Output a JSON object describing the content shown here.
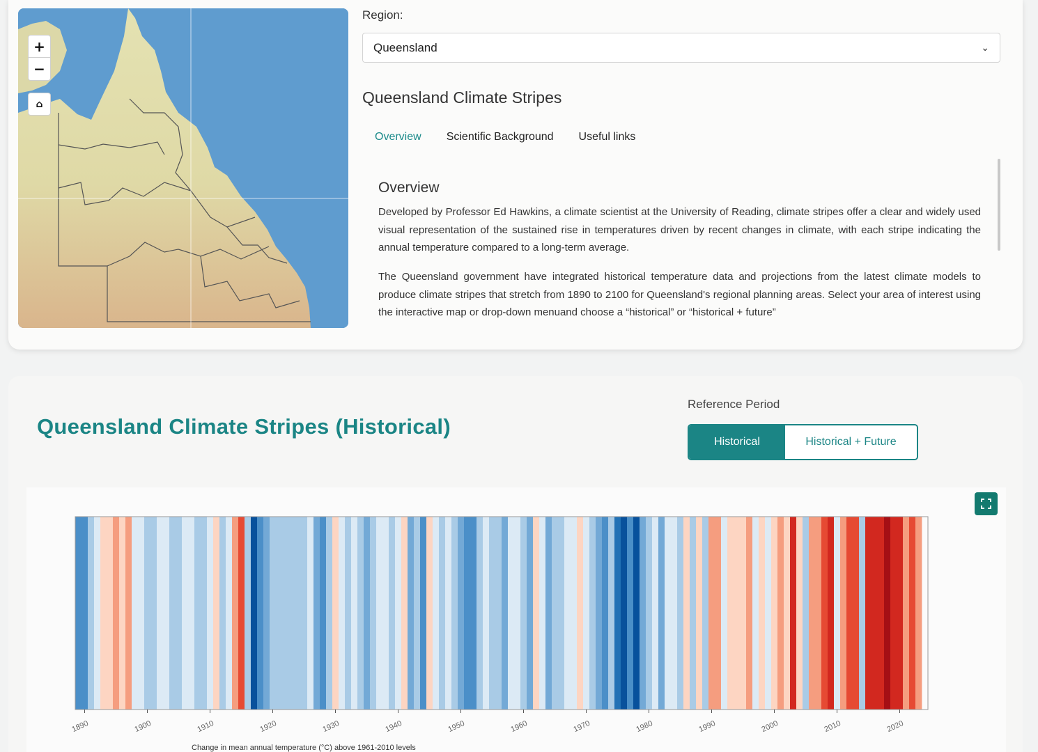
{
  "map": {
    "zoom_in_label": "+",
    "zoom_out_label": "−",
    "home_icon": "home-icon",
    "colors": {
      "sea": "#5f9ccf",
      "land": "#dcd9a6",
      "border": "#444444"
    }
  },
  "region": {
    "label": "Region:",
    "selected": "Queensland"
  },
  "info": {
    "title": "Queensland Climate Stripes",
    "tabs": [
      {
        "label": "Overview",
        "active": true
      },
      {
        "label": "Scientific Background",
        "active": false
      },
      {
        "label": "Useful links",
        "active": false
      }
    ],
    "overview_heading": "Overview",
    "paragraph_1": "Developed by Professor Ed Hawkins, a climate scientist at the University of Reading, climate stripes offer a clear and widely used visual representation of the sustained rise in temperatures driven by recent changes in climate, with each stripe indicating the annual temperature compared to a long-term average.",
    "paragraph_2": "The Queensland government have integrated historical temperature data and projections from the latest climate models to produce climate stripes that stretch from 1890 to 2100 for Queensland's regional planning areas. Select your area of interest using the interactive map or drop-down menuand choose a “historical” or “historical + future”"
  },
  "stripes_section": {
    "title": "Queensland Climate Stripes (Historical)",
    "reference_label": "Reference Period",
    "toggle_historical": "Historical",
    "toggle_future": "Historical + Future",
    "fullscreen_icon": "fullscreen-icon",
    "accent_color": "#1b8585"
  },
  "chart_data": {
    "type": "heatmap",
    "title": "",
    "xlabel": "Change in mean annual temperature (°C) above 1961-2010 levels",
    "ylabel": "",
    "x_range": [
      1889,
      2024
    ],
    "x_ticks": [
      1890,
      1900,
      1910,
      1920,
      1930,
      1940,
      1950,
      1960,
      1970,
      1980,
      1990,
      2000,
      2010,
      2020
    ],
    "grid": false,
    "legend": "none",
    "color_scale": "blue-white-red diverging",
    "levels": [
      -3,
      -3,
      -1,
      0,
      1,
      1,
      2,
      1,
      2,
      0,
      0,
      -1,
      -1,
      0,
      0,
      -1,
      -1,
      0,
      0,
      -1,
      -1,
      0,
      1,
      -1,
      0,
      2,
      3,
      -1,
      -5,
      -3,
      -2,
      -1,
      -1,
      -1,
      -1,
      -1,
      -1,
      0,
      -2,
      -3,
      -1,
      1,
      0,
      -1,
      0,
      -1,
      -2,
      -1,
      0,
      0,
      -1,
      0,
      1,
      -2,
      -1,
      -3,
      1,
      0,
      -1,
      0,
      -1,
      -2,
      -3,
      -3,
      -1,
      0,
      -1,
      -1,
      -2,
      0,
      0,
      -1,
      -2,
      1,
      0,
      -2,
      -1,
      -1,
      0,
      0,
      1,
      0,
      -1,
      -2,
      -3,
      -1,
      -4,
      -5,
      -3,
      -5,
      -2,
      -1,
      0,
      -2,
      0,
      0,
      -1,
      1,
      -1,
      1,
      -1,
      2,
      2,
      0,
      1,
      1,
      1,
      2,
      0,
      1,
      0,
      1,
      2,
      1,
      4,
      1,
      -1,
      2,
      2,
      3,
      4,
      0,
      2,
      3,
      3,
      -1,
      4,
      4,
      4,
      5,
      4,
      4,
      2,
      3,
      2
    ]
  }
}
